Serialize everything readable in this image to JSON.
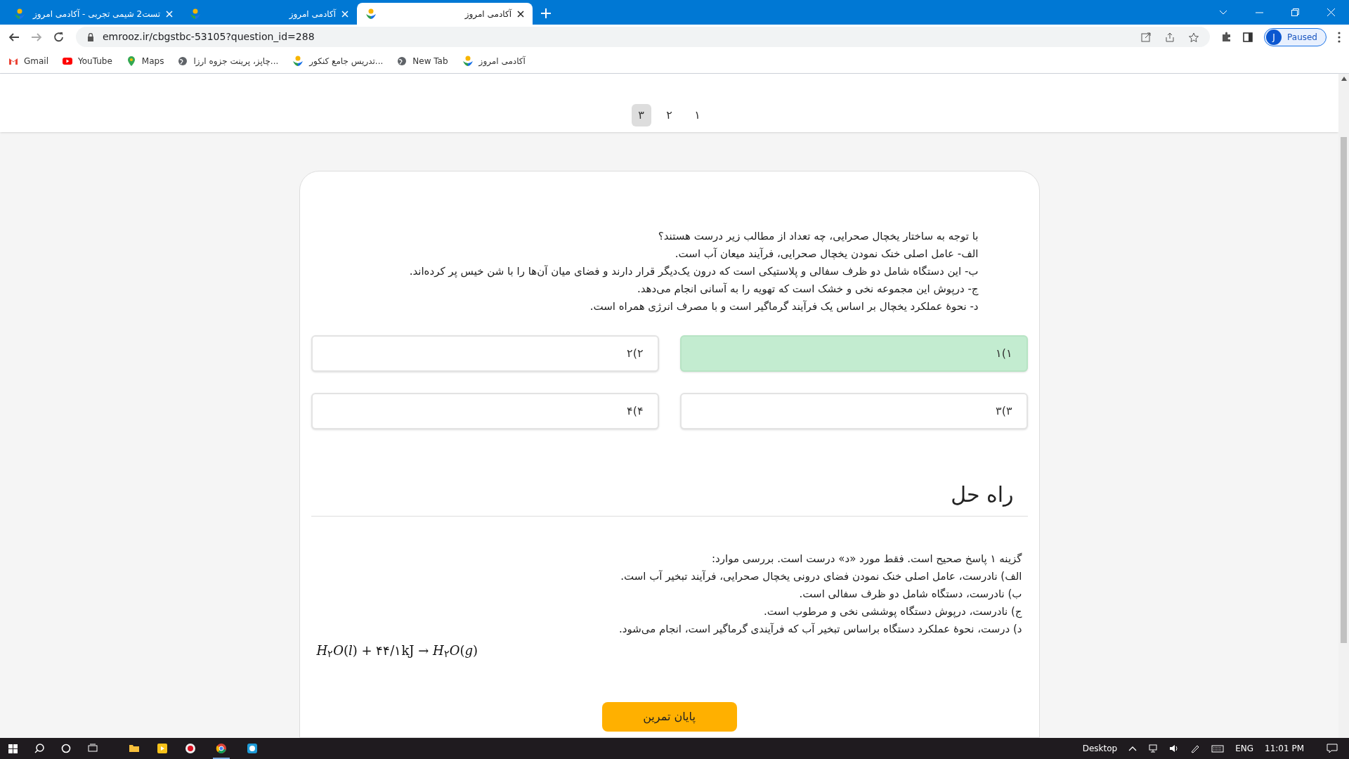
{
  "browser": {
    "tabs": [
      {
        "title": "آکادمی امروز",
        "selected": true
      },
      {
        "title": "آکادمی امروز",
        "selected": false
      },
      {
        "title": "تست2 شیمی تجربی - آکادمی امروز",
        "selected": false
      }
    ],
    "address": "emrooz.ir/cbgstbc-53105?question_id=288",
    "profile": {
      "initial": "J",
      "label": "Paused"
    },
    "bookmarks": [
      {
        "label": "آکادمی امروز",
        "kind": "logo"
      },
      {
        "label": "New Tab",
        "kind": "globe"
      },
      {
        "label": "تدریس جامع کنکور...",
        "kind": "logo"
      },
      {
        "label": "چاپز، پرینت جزوه ارزا...",
        "kind": "globe"
      },
      {
        "label": "Maps",
        "kind": "maps"
      },
      {
        "label": "YouTube",
        "kind": "youtube"
      },
      {
        "label": "Gmail",
        "kind": "gmail"
      }
    ]
  },
  "pagination": [
    {
      "label": "۱",
      "selected": false
    },
    {
      "label": "۲",
      "selected": false
    },
    {
      "label": "۳",
      "selected": true
    }
  ],
  "question": {
    "lines": [
      "با توجه به ساختار یخچال صحرایی، چه تعداد از مطالب زیر درست هستند؟",
      "الف- عامل اصلی خنک نمودن یخچال صحرایی، فرآیند میعان آب است.",
      "ب- این دستگاه شامل دو ظرف سفالی و پلاستیکی است که درون یک‌دیگر قرار دارند و فضای میان آن‌ها را با شن خیس پر کرده‌اند.",
      "ج- درپوش این مجموعه نخی و خشک است که تهویه را به آسانی انجام می‌دهد.",
      "د- نحوهٔ عملکرد یخچال بر اساس یک فرآیند گرماگیر است و با مصرف انرژی همراه است."
    ],
    "options": [
      {
        "label": "۱)۱",
        "selected": true
      },
      {
        "label": "۲)۲",
        "selected": false
      },
      {
        "label": "۳)۳",
        "selected": false
      },
      {
        "label": "۴)۴",
        "selected": false
      }
    ]
  },
  "solution": {
    "heading": "راه حل",
    "lines": [
      "گزینه ۱ پاسخ صحیح است. فقط مورد «د» درست است. بررسی موارد:",
      "الف) نادرست، عامل اصلی خنک نمودن فضای درونی یخچال صحرایی، فرآیند تبخیر آب است.",
      "ب) نادرست، دستگاه شامل دو ظرف سفالی است.",
      "ج) نادرست، درپوش دستگاه پوششی نخی و مرطوب است.",
      "د) درست، نحوهٔ عملکرد دستگاه براساس تبخیر آب که فرآیندی گرماگیر است، انجام می‌شود."
    ],
    "equation": "*H*$_{۲}$*O*(*l*) + ۴۴/۱kJ → *H*$_{۲}$*O*(*g*)"
  },
  "finish_button": "پایان تمرین",
  "taskbar": {
    "desktop": "Desktop",
    "language": "ENG",
    "time": "11:01 PM"
  }
}
